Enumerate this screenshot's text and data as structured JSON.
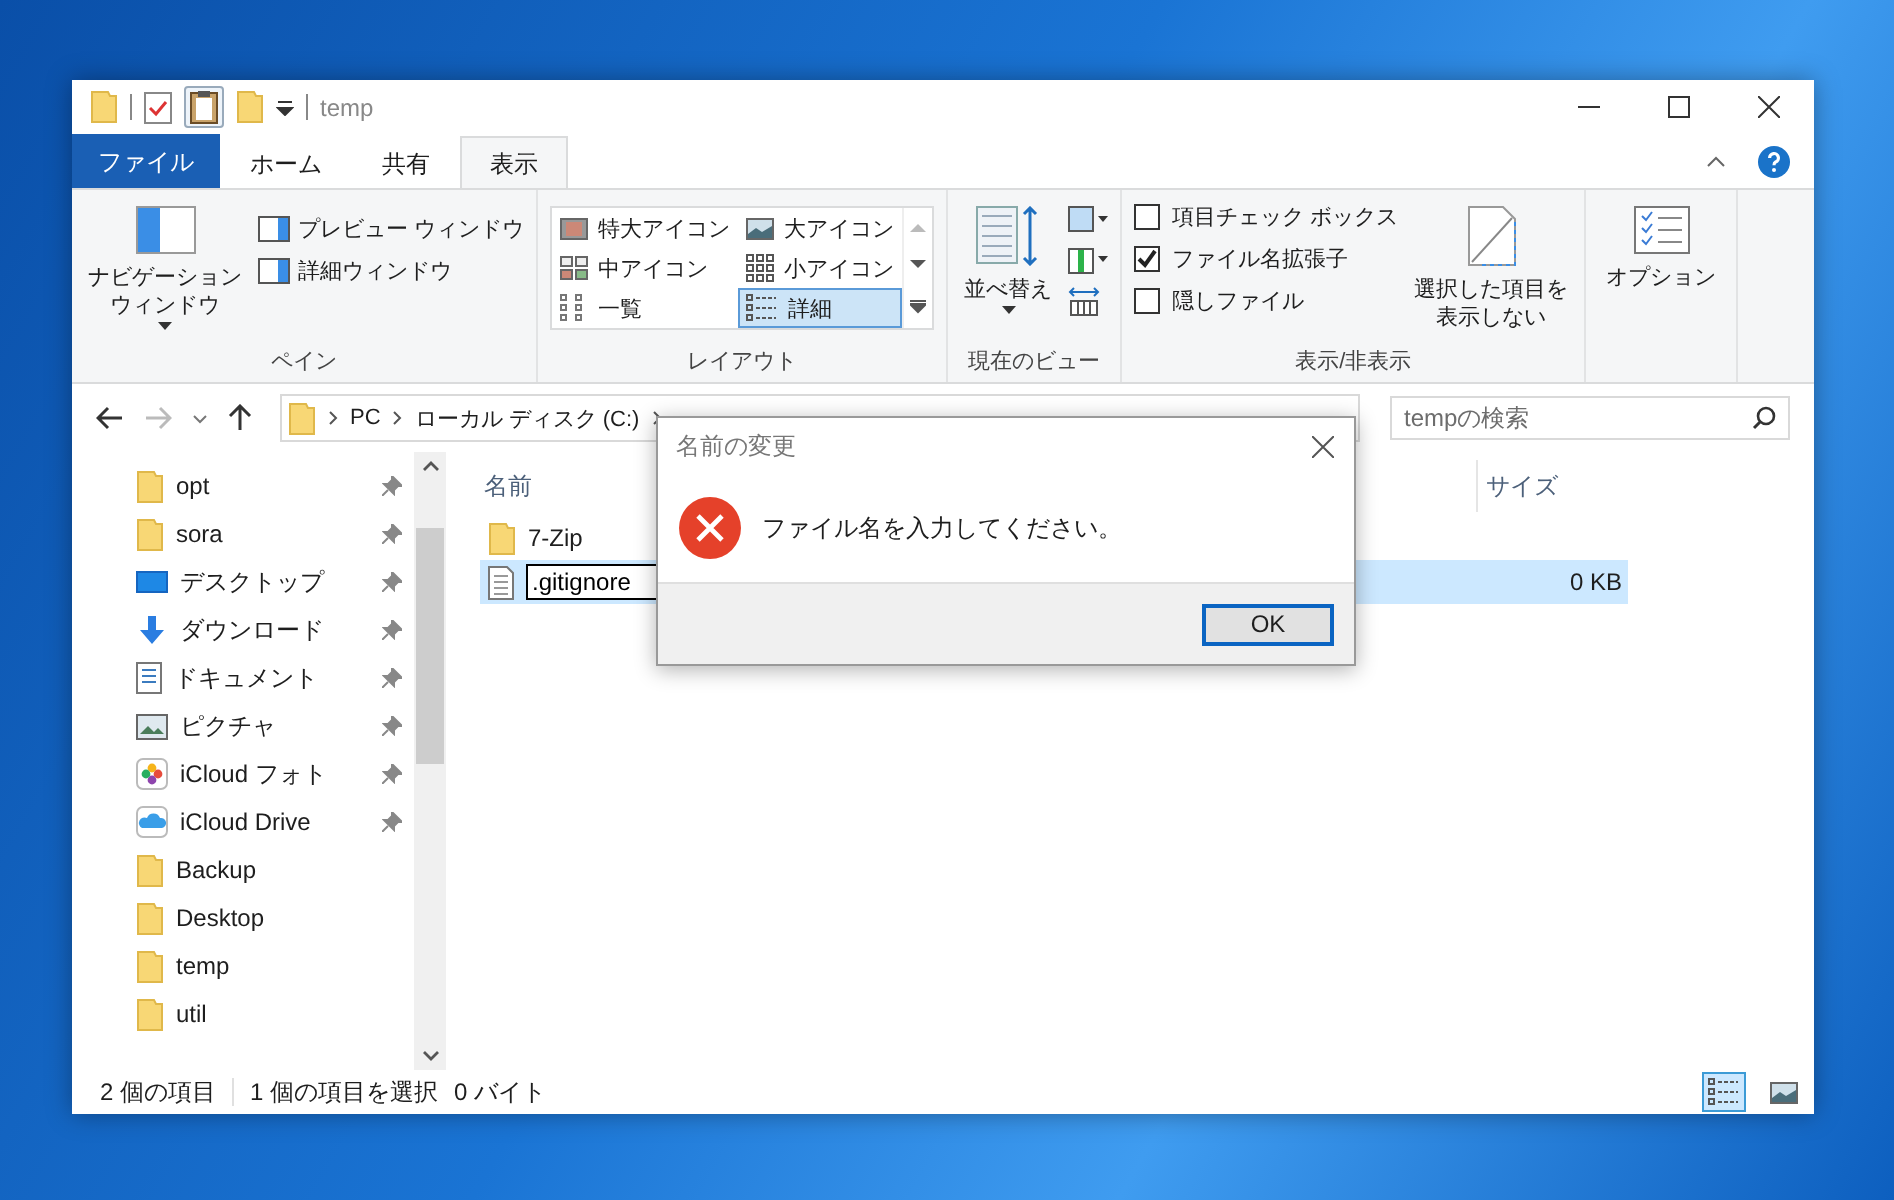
{
  "window": {
    "title": "temp"
  },
  "ribbon_tabs": [
    {
      "label": "ファイル",
      "kind": "file",
      "selected": false
    },
    {
      "label": "ホーム",
      "kind": "tab",
      "selected": false
    },
    {
      "label": "共有",
      "kind": "tab",
      "selected": false
    },
    {
      "label": "表示",
      "kind": "tab",
      "selected": true
    }
  ],
  "ribbon": {
    "pane": {
      "label": "ペイン",
      "navigation_pane": [
        "ナビゲーション",
        "ウィンドウ"
      ],
      "preview_pane": "プレビュー ウィンドウ",
      "details_pane": "詳細ウィンドウ"
    },
    "layout": {
      "label": "レイアウト",
      "options": [
        {
          "label": "特大アイコン",
          "kind": "xl",
          "selected": false
        },
        {
          "label": "大アイコン",
          "kind": "large",
          "selected": false
        },
        {
          "label": "中アイコン",
          "kind": "medium",
          "selected": false
        },
        {
          "label": "小アイコン",
          "kind": "small",
          "selected": false
        },
        {
          "label": "一覧",
          "kind": "list",
          "selected": false
        },
        {
          "label": "詳細",
          "kind": "details",
          "selected": true
        }
      ]
    },
    "current_view": {
      "label": "現在のビュー",
      "sort": "並べ替え"
    },
    "show_hide": {
      "label": "表示/非表示",
      "checkboxes": [
        {
          "label": "項目チェック ボックス",
          "checked": false
        },
        {
          "label": "ファイル名拡張子",
          "checked": true
        },
        {
          "label": "隠しファイル",
          "checked": false
        }
      ],
      "hide_selected": [
        "選択した項目を",
        "表示しない"
      ]
    },
    "options": {
      "label": "オプション"
    }
  },
  "address_bar": {
    "breadcrumbs": [
      "PC",
      "ローカル ディスク (C:)"
    ]
  },
  "search": {
    "placeholder": "tempの検索"
  },
  "navigation": [
    {
      "label": "opt",
      "kind": "folder",
      "pinned": true
    },
    {
      "label": "sora",
      "kind": "folder",
      "pinned": true
    },
    {
      "label": "デスクトップ",
      "kind": "desktop",
      "pinned": true
    },
    {
      "label": "ダウンロード",
      "kind": "download",
      "pinned": true
    },
    {
      "label": "ドキュメント",
      "kind": "document",
      "pinned": true
    },
    {
      "label": "ピクチャ",
      "kind": "picture",
      "pinned": true
    },
    {
      "label": "iCloud フォト",
      "kind": "photos",
      "pinned": true
    },
    {
      "label": "iCloud Drive",
      "kind": "cloud",
      "pinned": true
    },
    {
      "label": "Backup",
      "kind": "folder",
      "pinned": false
    },
    {
      "label": "Desktop",
      "kind": "folder",
      "pinned": false
    },
    {
      "label": "temp",
      "kind": "folder",
      "pinned": false
    },
    {
      "label": "util",
      "kind": "folder",
      "pinned": false
    }
  ],
  "columns": [
    "名前",
    "サイズ"
  ],
  "files": [
    {
      "name": "7-Zip",
      "kind": "folder",
      "selected": false,
      "renaming": false
    },
    {
      "name": ".gitignore",
      "kind": "file",
      "size": "0 KB",
      "selected": true,
      "renaming": true
    }
  ],
  "status_bar": {
    "item_count": "2 個の項目",
    "selection": "1 個の項目を選択",
    "size": "0 バイト",
    "views": [
      {
        "kind": "details",
        "selected": true
      },
      {
        "kind": "large",
        "selected": false
      }
    ]
  },
  "dialog": {
    "title": "名前の変更",
    "message": "ファイル名を入力してください。",
    "button": "OK"
  }
}
